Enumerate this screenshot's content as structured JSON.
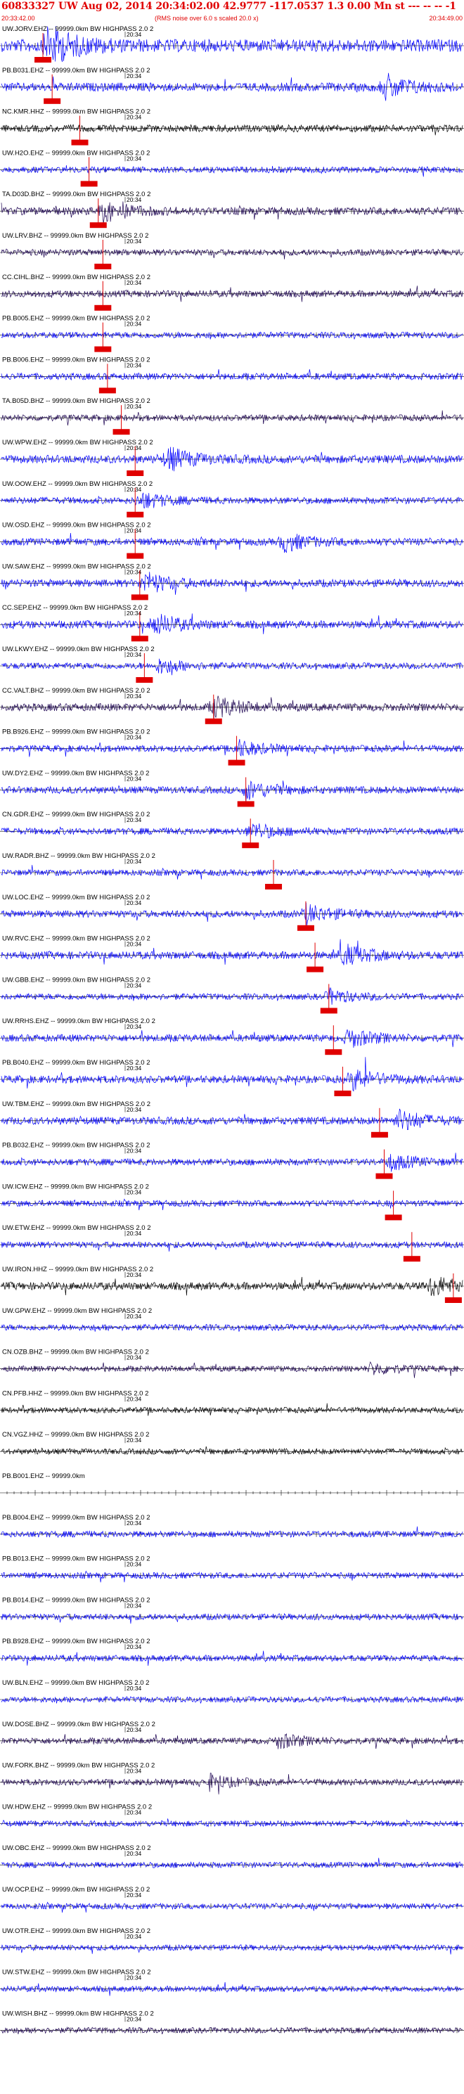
{
  "header": {
    "title": "60833327 UW Aug 02, 2014 20:34:02.00    42.9777 -117.0537  1.3 0.00 Mn st --- -- --   -1",
    "start_time": "20:33:42.00",
    "rms_note": "(RMS noise over 6.0 s scaled 20.0 x)",
    "end_time": "20:34:49.00",
    "text_color": "#e00000"
  },
  "trace_time_label": "20:34",
  "colors": {
    "blue": "#0000ff",
    "dark": "#1a0050",
    "black": "#000000",
    "pick": "#e00000",
    "axis": "#000000"
  },
  "traces": [
    {
      "label": "UW.JORV.EHZ -- 99999.0km BW  HIGHPASS  2.0  2",
      "color": "blue",
      "amp": 1.0,
      "pick": 0.09,
      "burst": 0.1
    },
    {
      "label": "PB.B031.EHZ -- 99999.0km BW  HIGHPASS  2.0  2",
      "color": "blue",
      "amp": 0.6,
      "pick": 0.11,
      "burst": 0.83
    },
    {
      "label": "NC.KMR.HHZ -- 99999.0km BW  HIGHPASS  2.0  2",
      "color": "black",
      "amp": 0.45,
      "pick": 0.17,
      "burst": null
    },
    {
      "label": "UW.H2O.EHZ -- 99999.0km BW  HIGHPASS  2.0  2",
      "color": "blue",
      "amp": 0.35,
      "pick": 0.19,
      "burst": null
    },
    {
      "label": "TA.D03D.BHZ -- 99999.0km BW  HIGHPASS  2.0  2",
      "color": "dark",
      "amp": 0.5,
      "pick": 0.21,
      "burst": 0.22
    },
    {
      "label": "UW.LRV.BHZ -- 99999.0km BW  HIGHPASS  2.0  2",
      "color": "dark",
      "amp": 0.35,
      "pick": 0.22,
      "burst": null
    },
    {
      "label": "CC.CIHL.BHZ -- 99999.0km BW  HIGHPASS  2.0  2",
      "color": "dark",
      "amp": 0.4,
      "pick": 0.22,
      "burst": null
    },
    {
      "label": "PB.B005.EHZ -- 99999.0km BW  HIGHPASS  2.0  2",
      "color": "blue",
      "amp": 0.35,
      "pick": 0.22,
      "burst": null
    },
    {
      "label": "PB.B006.EHZ -- 99999.0km BW  HIGHPASS  2.0  2",
      "color": "blue",
      "amp": 0.4,
      "pick": 0.23,
      "burst": null
    },
    {
      "label": "TA.B05D.BHZ -- 99999.0km BW  HIGHPASS  2.0  2",
      "color": "dark",
      "amp": 0.35,
      "pick": 0.26,
      "burst": null
    },
    {
      "label": "UW.WPW.EHZ -- 99999.0km BW  HIGHPASS  2.0  2",
      "color": "blue",
      "amp": 0.55,
      "pick": 0.29,
      "burst": 0.36
    },
    {
      "label": "UW.OOW.EHZ -- 99999.0km BW  HIGHPASS  2.0  2",
      "color": "blue",
      "amp": 0.4,
      "pick": 0.29,
      "burst": 0.3
    },
    {
      "label": "UW.OSD.EHZ -- 99999.0km BW  HIGHPASS  2.0  2",
      "color": "blue",
      "amp": 0.45,
      "pick": 0.29,
      "burst": 0.61
    },
    {
      "label": "UW.SAW.EHZ -- 99999.0km BW  HIGHPASS  2.0  2",
      "color": "blue",
      "amp": 0.5,
      "pick": 0.3,
      "burst": 0.31
    },
    {
      "label": "CC.SEP.EHZ -- 99999.0km BW  HIGHPASS  2.0  2",
      "color": "blue",
      "amp": 0.5,
      "pick": 0.3,
      "burst": 0.33
    },
    {
      "label": "UW.LKWY.EHZ -- 99999.0km BW  HIGHPASS  2.0  2",
      "color": "blue",
      "amp": 0.35,
      "pick": 0.31,
      "burst": 0.34
    },
    {
      "label": "CC.VALT.BHZ -- 99999.0km BW  HIGHPASS  2.0  2",
      "color": "dark",
      "amp": 0.5,
      "pick": 0.46,
      "burst": 0.46
    },
    {
      "label": "PB.B926.EHZ -- 99999.0km BW  HIGHPASS  2.0  2",
      "color": "blue",
      "amp": 0.4,
      "pick": 0.51,
      "burst": 0.51
    },
    {
      "label": "UW.DY2.EHZ -- 99999.0km BW  HIGHPASS  2.0  2",
      "color": "blue",
      "amp": 0.45,
      "pick": 0.53,
      "burst": 0.53
    },
    {
      "label": "CN.GDR.EHZ -- 99999.0km BW  HIGHPASS  2.0  2",
      "color": "blue",
      "amp": 0.4,
      "pick": 0.54,
      "burst": 0.54
    },
    {
      "label": "UW.RADR.BHZ -- 99999.0km BW  HIGHPASS  2.0  2",
      "color": "blue",
      "amp": 0.35,
      "pick": 0.59,
      "burst": null
    },
    {
      "label": "UW.LOC.EHZ -- 99999.0km BW  HIGHPASS  2.0  2",
      "color": "blue",
      "amp": 0.45,
      "pick": 0.66,
      "burst": 0.66
    },
    {
      "label": "UW.RVC.EHZ -- 99999.0km BW  HIGHPASS  2.0  2",
      "color": "blue",
      "amp": 0.5,
      "pick": 0.68,
      "burst": 0.74
    },
    {
      "label": "UW.GBB.EHZ -- 99999.0km BW  HIGHPASS  2.0  2",
      "color": "blue",
      "amp": 0.35,
      "pick": 0.71,
      "burst": 0.71
    },
    {
      "label": "UW.RRHS.EHZ -- 99999.0km BW  HIGHPASS  2.0  2",
      "color": "blue",
      "amp": 0.45,
      "pick": 0.72,
      "burst": 0.75
    },
    {
      "label": "PB.B040.EHZ -- 99999.0km BW  HIGHPASS  2.0  2",
      "color": "blue",
      "amp": 0.5,
      "pick": 0.74,
      "burst": 0.76
    },
    {
      "label": "UW.TBM.EHZ -- 99999.0km BW  HIGHPASS  2.0  2",
      "color": "blue",
      "amp": 0.5,
      "pick": 0.82,
      "burst": 0.86
    },
    {
      "label": "PB.B032.EHZ -- 99999.0km BW  HIGHPASS  2.0  2",
      "color": "blue",
      "amp": 0.4,
      "pick": 0.83,
      "burst": 0.84
    },
    {
      "label": "UW.ICW.EHZ -- 99999.0km BW  HIGHPASS  2.0  2",
      "color": "blue",
      "amp": 0.35,
      "pick": 0.85,
      "burst": null
    },
    {
      "label": "UW.ETW.EHZ -- 99999.0km BW  HIGHPASS  2.0  2",
      "color": "blue",
      "amp": 0.35,
      "pick": 0.89,
      "burst": null
    },
    {
      "label": "UW.IRON.HHZ -- 99999.0km BW  HIGHPASS  2.0  2",
      "color": "black",
      "amp": 0.5,
      "pick": 0.98,
      "burst": 0.93
    },
    {
      "label": "UW.GPW.EHZ -- 99999.0km BW  HIGHPASS  2.0  2",
      "color": "blue",
      "amp": 0.35,
      "pick": null,
      "burst": null
    },
    {
      "label": "CN.OZB.BHZ -- 99999.0km BW  HIGHPASS  2.0  2",
      "color": "dark",
      "amp": 0.3,
      "pick": null,
      "burst": 0.8
    },
    {
      "label": "CN.PFB.HHZ -- 99999.0km BW  HIGHPASS  2.0  2",
      "color": "black",
      "amp": 0.3,
      "pick": null,
      "burst": null
    },
    {
      "label": "CN.VGZ.HHZ -- 99999.0km BW  HIGHPASS  2.0  2",
      "color": "black",
      "amp": 0.3,
      "pick": null,
      "burst": null
    },
    {
      "label": "PB.B001.EHZ -- 99999.0km",
      "color": "blue",
      "amp": 0.0,
      "pick": null,
      "burst": null
    },
    {
      "label": "PB.B004.EHZ -- 99999.0km BW  HIGHPASS  2.0  2",
      "color": "blue",
      "amp": 0.35,
      "pick": null,
      "burst": null
    },
    {
      "label": "PB.B013.EHZ -- 99999.0km BW  HIGHPASS  2.0  2",
      "color": "blue",
      "amp": 0.35,
      "pick": null,
      "burst": null
    },
    {
      "label": "PB.B014.EHZ -- 99999.0km BW  HIGHPASS  2.0  2",
      "color": "blue",
      "amp": 0.35,
      "pick": null,
      "burst": null
    },
    {
      "label": "PB.B928.EHZ -- 99999.0km BW  HIGHPASS  2.0  2",
      "color": "blue",
      "amp": 0.35,
      "pick": null,
      "burst": null
    },
    {
      "label": "UW.BLN.EHZ -- 99999.0km BW  HIGHPASS  2.0  2",
      "color": "blue",
      "amp": 0.3,
      "pick": null,
      "burst": null
    },
    {
      "label": "UW.DOSE.BHZ -- 99999.0km BW  HIGHPASS  2.0  2",
      "color": "dark",
      "amp": 0.35,
      "pick": null,
      "burst": 0.6
    },
    {
      "label": "UW.FORK.BHZ -- 99999.0km BW  HIGHPASS  2.0  2",
      "color": "dark",
      "amp": 0.35,
      "pick": null,
      "burst": 0.45
    },
    {
      "label": "UW.HDW.EHZ -- 99999.0km BW  HIGHPASS  2.0  2",
      "color": "blue",
      "amp": 0.3,
      "pick": null,
      "burst": null
    },
    {
      "label": "UW.OBC.EHZ -- 99999.0km BW  HIGHPASS  2.0  2",
      "color": "blue",
      "amp": 0.3,
      "pick": null,
      "burst": null
    },
    {
      "label": "UW.OCP.EHZ -- 99999.0km BW  HIGHPASS  2.0  2",
      "color": "blue",
      "amp": 0.3,
      "pick": null,
      "burst": null
    },
    {
      "label": "UW.OTR.EHZ -- 99999.0km BW  HIGHPASS  2.0  2",
      "color": "blue",
      "amp": 0.3,
      "pick": null,
      "burst": null
    },
    {
      "label": "UW.STW.EHZ -- 99999.0km BW  HIGHPASS  2.0  2",
      "color": "blue",
      "amp": 0.3,
      "pick": null,
      "burst": null
    },
    {
      "label": "UW.WISH.BHZ -- 99999.0km BW  HIGHPASS  2.0  2",
      "color": "dark",
      "amp": 0.3,
      "pick": null,
      "burst": null
    }
  ]
}
